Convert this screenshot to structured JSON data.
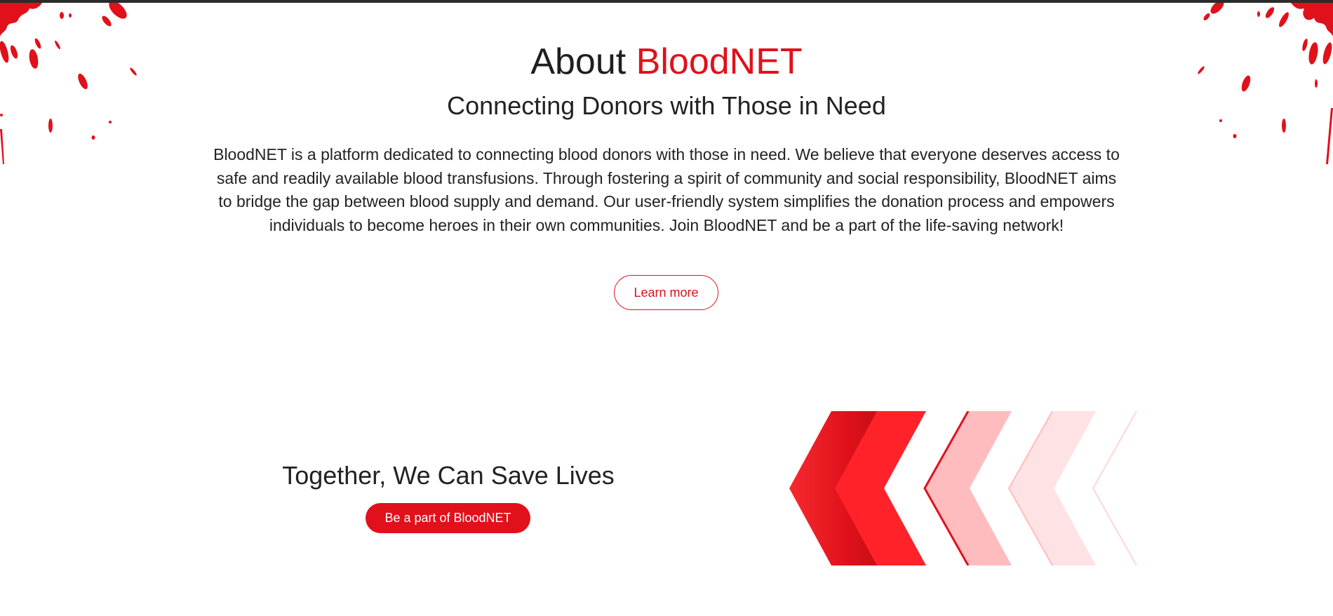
{
  "about": {
    "title_prefix": "About",
    "title_brand": "BloodNET",
    "subtitle": "Connecting Donors with Those in Need",
    "description": "BloodNET is a platform dedicated to connecting blood donors with those in need. We believe that everyone deserves access to safe and readily available blood transfusions. Through fostering a spirit of community and social responsibility, BloodNET aims to bridge the gap between blood supply and demand. Our user-friendly system simplifies the donation process and empowers individuals to become heroes in their own communities. Join BloodNET and be a part of the life-saving network!",
    "learn_more_label": "Learn more"
  },
  "cta": {
    "title": "Together, We Can Save Lives",
    "button_label": "Be a part of BloodNET"
  },
  "theme": {
    "accent": "#e0111b",
    "text": "#222222",
    "background": "#ffffff"
  },
  "decorations": {
    "splatter_left": "blood-splatter-icon",
    "splatter_right": "blood-splatter-icon",
    "chevrons": "chevron-arrows-graphic"
  }
}
